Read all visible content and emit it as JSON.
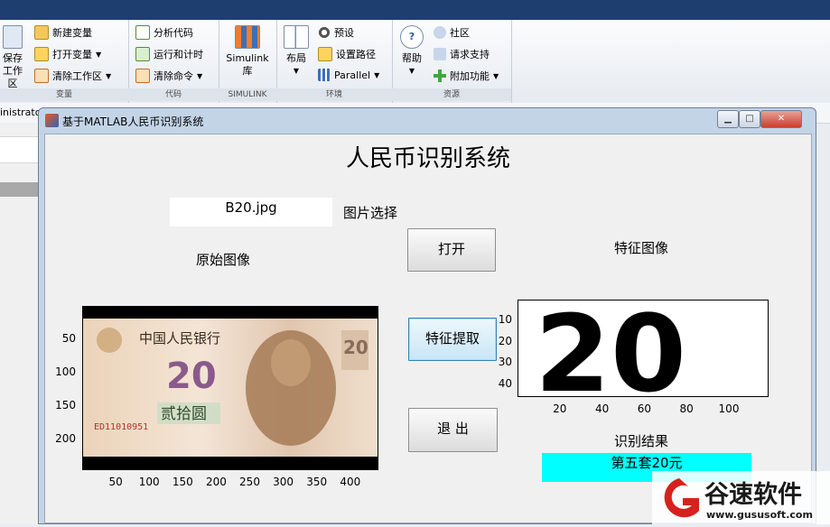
{
  "ribbon": {
    "variable_group": {
      "label": "变量",
      "save_part": "保存",
      "workspace_part": "工作区",
      "new_variable": "新建变量",
      "open_variable": "打开变量",
      "clear_workspace": "清除工作区"
    },
    "code_group": {
      "label": "代码",
      "analyze_code": "分析代码",
      "run_and_time": "运行和计时",
      "clear_commands": "清除命令"
    },
    "simulink_group": {
      "label": "SIMULINK",
      "simulink_line1": "Simulink",
      "simulink_line2": "库"
    },
    "environment_group": {
      "label": "环境",
      "layout": "布局",
      "preferences": "预设",
      "set_path": "设置路径",
      "parallel": "Parallel"
    },
    "resources_group": {
      "label": "资源",
      "help": "帮助",
      "community": "社区",
      "request_support": "请求支持",
      "add_ons": "附加功能"
    }
  },
  "address": {
    "user_fragment": "inistrato"
  },
  "window": {
    "title": "基于MATLAB人民币识别系统",
    "minimize": "▁",
    "maximize": "□",
    "close": "✕"
  },
  "app": {
    "main_title": "人民币识别系统",
    "filename": "B20.jpg",
    "pick_image_label": "图片选择",
    "original_image_label": "原始图像",
    "feature_image_label": "特征图像",
    "open_button": "打开",
    "extract_button": "特征提取",
    "exit_button": "退  出",
    "result_label": "识别结果",
    "result_value": "第五套20元"
  },
  "axes": {
    "original": {
      "x_ticks": [
        "50",
        "100",
        "150",
        "200",
        "250",
        "300",
        "350",
        "400"
      ],
      "y_ticks": [
        "50",
        "100",
        "150",
        "200"
      ]
    },
    "feature": {
      "x_ticks": [
        "20",
        "40",
        "60",
        "80",
        "100"
      ],
      "y_ticks": [
        "10",
        "20",
        "30",
        "40"
      ],
      "digits": "20"
    }
  },
  "banknote": {
    "bank_name": "中国人民银行",
    "denomination": "20",
    "chinese_amount": "贰拾圆",
    "serial": "ED11010951"
  },
  "watermark": {
    "brand": "谷速软件",
    "url": "www.gususoft.com"
  },
  "colors": {
    "result_bg": "#00ffff",
    "titlebar": "#c4d4e7",
    "brand_red": "#d6221c"
  }
}
